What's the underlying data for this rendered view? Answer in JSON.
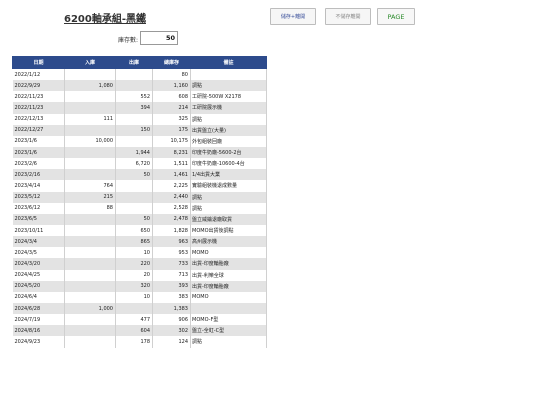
{
  "header": {
    "title": "6200軸承組-黑鐵",
    "buttons": [
      "儲存+離開",
      "不儲存離開",
      "PAGE"
    ]
  },
  "stock": {
    "label": "庫存數:",
    "value": "50"
  },
  "table": {
    "columns": [
      "日期",
      "入庫",
      "出庫",
      "總庫存",
      "備註"
    ],
    "rows": [
      [
        "2022/1/12",
        "",
        "",
        "80",
        ""
      ],
      [
        "2022/9/29",
        "1,080",
        "",
        "1,160",
        "調點"
      ],
      [
        "2022/11/23",
        "",
        "552",
        "608",
        "工研院-500W X2178"
      ],
      [
        "2022/11/23",
        "",
        "394",
        "214",
        "工研院展示機"
      ],
      [
        "2022/12/13",
        "111",
        "",
        "325",
        "調點"
      ],
      [
        "2022/12/27",
        "",
        "150",
        "175",
        "出貨盤立(大量)"
      ],
      [
        "2023/1/6",
        "10,000",
        "",
        "10,175",
        "外包組裝回廠"
      ],
      [
        "2023/1/6",
        "",
        "1,944",
        "8,231",
        "印度牛奶廠-5600-2台"
      ],
      [
        "2023/2/6",
        "",
        "6,720",
        "1,511",
        "印度牛奶廠-10600-4台"
      ],
      [
        "2023/2/16",
        "",
        "50",
        "1,461",
        "1/4出貨大業"
      ],
      [
        "2023/4/14",
        "764",
        "",
        "2,225",
        "實驗組裝機退成數量"
      ],
      [
        "2023/5/12",
        "215",
        "",
        "2,440",
        "調點"
      ],
      [
        "2023/6/12",
        "88",
        "",
        "2,528",
        "調點"
      ],
      [
        "2023/6/5",
        "",
        "50",
        "2,478",
        "盤立威鑰退廠取貨"
      ],
      [
        "2023/10/11",
        "",
        "650",
        "1,828",
        "MOMO出貨後調點"
      ],
      [
        "2024/3/4",
        "",
        "865",
        "963",
        "高州展示機"
      ],
      [
        "2024/3/5",
        "",
        "10",
        "953",
        "MOMO"
      ],
      [
        "2024/3/20",
        "",
        "220",
        "733",
        "出貨-印度輪胎廠"
      ],
      [
        "2024/4/25",
        "",
        "20",
        "713",
        "出貨-利樂全球"
      ],
      [
        "2024/5/20",
        "",
        "320",
        "393",
        "出貨-印度輪胎廠"
      ],
      [
        "2024/6/4",
        "",
        "10",
        "383",
        "MOMO"
      ],
      [
        "2024/6/28",
        "1,000",
        "",
        "1,383",
        ""
      ],
      [
        "2024/7/19",
        "",
        "477",
        "906",
        "MOMO-F型"
      ],
      [
        "2024/8/16",
        "",
        "604",
        "302",
        "盤立-全虹-C型"
      ],
      [
        "2024/9/23",
        "",
        "178",
        "124",
        "調點"
      ]
    ]
  }
}
